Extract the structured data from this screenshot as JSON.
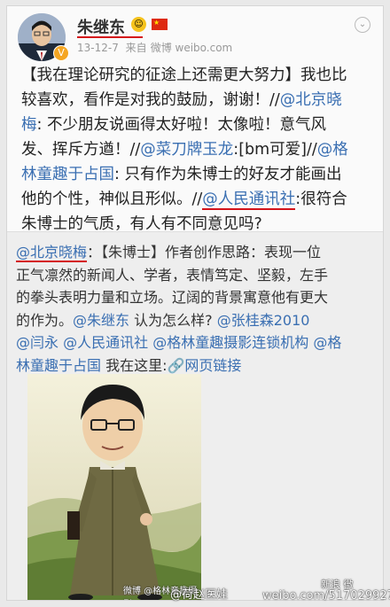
{
  "user": {
    "name": "朱继东",
    "time": "13-12-7",
    "source_prefix": "来自",
    "source": "微博 weibo.com"
  },
  "post": {
    "lines": [
      [
        {
          "t": "【我在理论研究的征途上还需更大努力】我也比"
        }
      ],
      [
        {
          "t": "较喜欢，看作是对我的鼓励，谢谢！//"
        },
        {
          "t": "@北京晓",
          "l": 1
        }
      ],
      [
        {
          "t": "梅",
          "l": 1
        },
        {
          "t": ": 不少朋友说画得太好啦！太像啦！意气风"
        }
      ],
      [
        {
          "t": "发、挥斥方遒！//"
        },
        {
          "t": "@菜刀牌玉龙",
          "l": 1
        },
        {
          "t": ":[bm可爱]//"
        },
        {
          "t": "@格",
          "l": 1
        }
      ],
      [
        {
          "t": "林童趣于占国",
          "l": 1
        },
        {
          "t": ": 只有作为朱博士的好友才能画出"
        }
      ],
      [
        {
          "t": "他的个性，神似且形似。//"
        },
        {
          "t": "@人民通讯社",
          "l": 1,
          "u": 1
        },
        {
          "t": ":很符合"
        }
      ],
      [
        {
          "t": "朱博士的气质，有人有不同意见吗?"
        }
      ]
    ]
  },
  "repost": {
    "lines": [
      [
        {
          "t": "@北京晓梅",
          "l": 1,
          "u": 1
        },
        {
          "t": "：【朱博士】作者创作思路：表现一位"
        }
      ],
      [
        {
          "t": "正气凛然的新闻人、学者，表情笃定、坚毅，左手"
        }
      ],
      [
        {
          "t": "的拳头表明力量和立场。辽阔的背景寓意他有更大"
        }
      ],
      [
        {
          "t": "的作为。"
        },
        {
          "t": "@朱继东",
          "l": 1
        },
        {
          "t": " 认为怎么样? "
        },
        {
          "t": "@张桂森2010",
          "l": 1
        }
      ],
      [
        {
          "t": "@闫永",
          "l": 1
        },
        {
          "t": " "
        },
        {
          "t": "@人民通讯社",
          "l": 1
        },
        {
          "t": " "
        },
        {
          "t": "@格林童趣摄影连锁机构",
          "l": 1
        },
        {
          "t": " "
        },
        {
          "t": "@格",
          "l": 1
        }
      ],
      [
        {
          "t": "林童趣于占国",
          "l": 1
        },
        {
          "t": "  我在这里:"
        },
        {
          "t": "🔗网页链接",
          "l": 1
        }
      ]
    ]
  },
  "image_watermark": "微博 @格林童趣摄影",
  "page_watermark": {
    "left": "@荷赵医娃",
    "site": "weibo.com/5170299275",
    "right": "新浪 微"
  },
  "colors": {
    "link": "#3a6fb2",
    "underline": "#d4141a"
  }
}
